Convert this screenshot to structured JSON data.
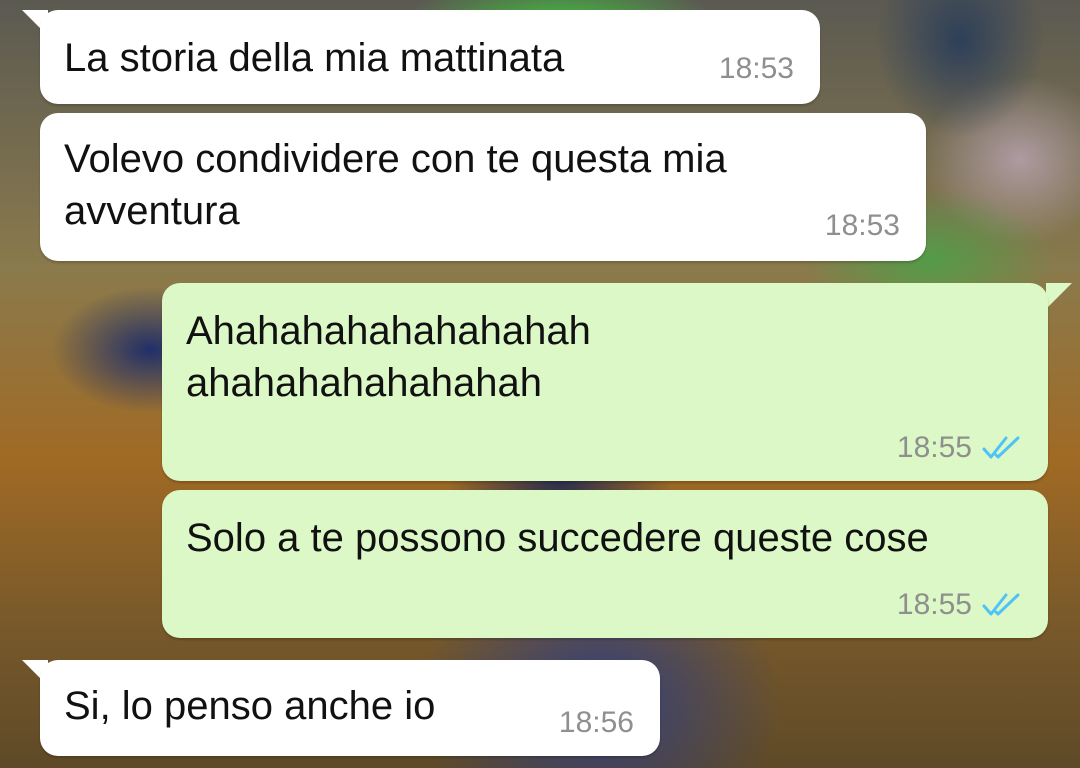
{
  "colors": {
    "incoming_bubble": "#ffffff",
    "outgoing_bubble": "#dcf8c6",
    "timestamp": "#8f8f8f",
    "read_ticks": "#4fc3f7"
  },
  "messages": [
    {
      "direction": "incoming",
      "text": "La storia della mia mattinata",
      "time": "18:53"
    },
    {
      "direction": "incoming",
      "text": "Volevo condividere con te questa mia\navventura",
      "time": "18:53"
    },
    {
      "direction": "outgoing",
      "text": "Ahahahahahahahahah\nahahahahahahahah",
      "time": "18:55",
      "status_icon": "double-check-read-icon"
    },
    {
      "direction": "outgoing",
      "text": "Solo a te possono succedere queste cose",
      "time": "18:55",
      "status_icon": "double-check-read-icon"
    },
    {
      "direction": "incoming",
      "text": "Si, lo penso anche io",
      "time": "18:56"
    }
  ]
}
